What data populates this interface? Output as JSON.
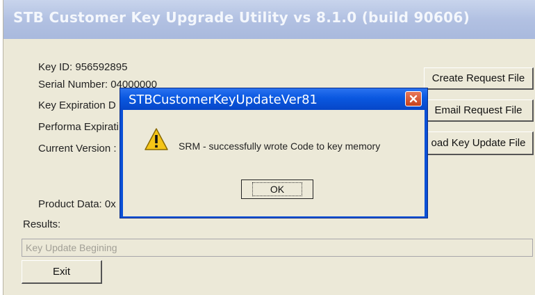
{
  "main_window": {
    "title": "STB Customer Key Upgrade Utility vs 8.1.0 (build 90606)",
    "key_id": "Key ID:  956592895",
    "serial_number": "Serial Number: 04000000",
    "key_expiration": "Key Expiration D",
    "performa_expiration": "Performa Expirati",
    "current_version": "Current Version :",
    "product_data": "Product Data: 0x",
    "results_label": "Results:",
    "results_value": "Key Update Begining",
    "buttons": {
      "create_request": "Create Request File",
      "email_request": "Email Request File",
      "load_key_update": "oad Key Update File",
      "exit": "Exit"
    }
  },
  "dialog": {
    "title": "STBCustomerKeyUpdateVer81",
    "message": "SRM - successfully wrote Code to key memory",
    "ok_label": "OK",
    "icon": "warning-icon"
  },
  "colors": {
    "window_face": "#ece9d8",
    "dialog_titlebar": "#0a58e0",
    "close_button": "#d9552f",
    "warning_yellow": "#f5c518"
  }
}
